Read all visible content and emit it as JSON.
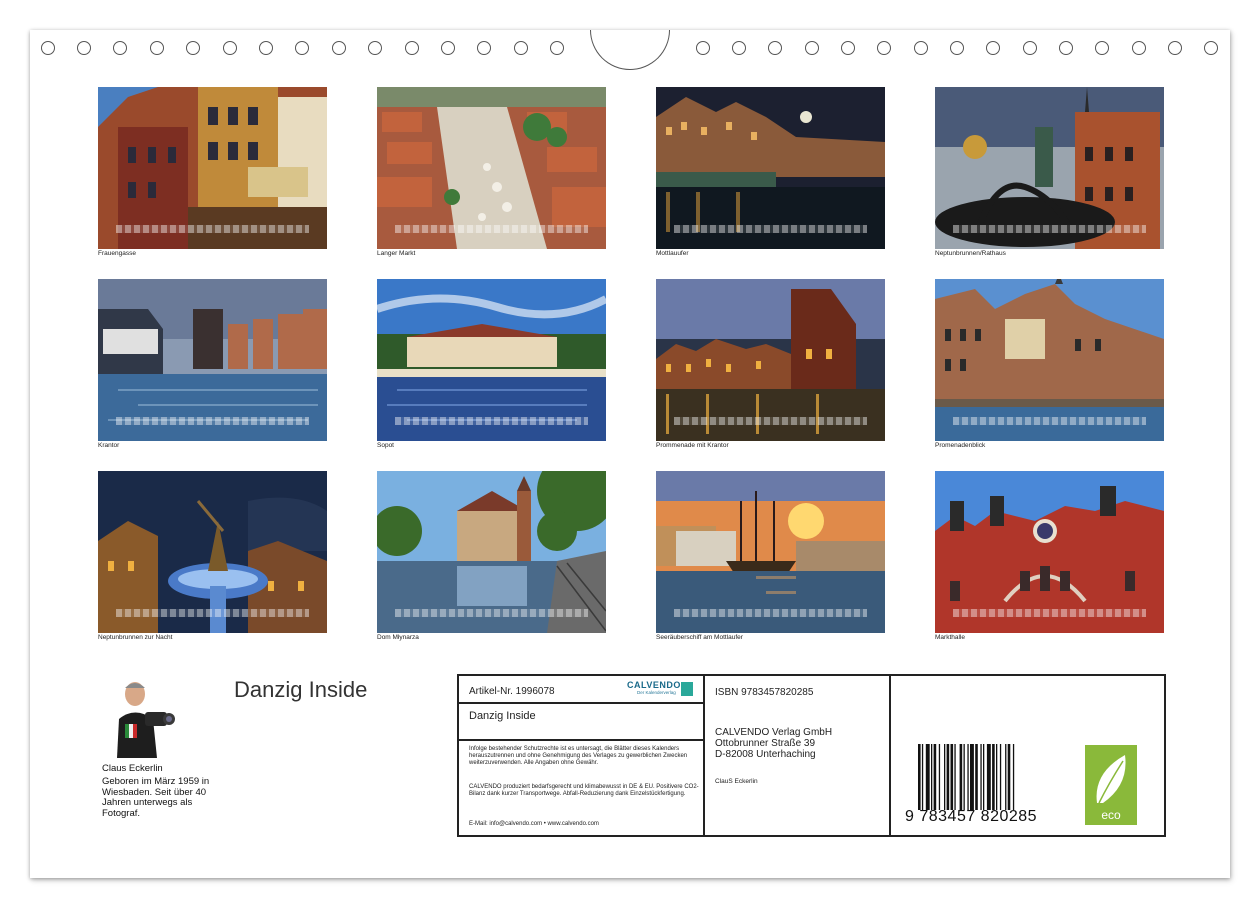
{
  "photos": [
    {
      "caption": "Frauengasse"
    },
    {
      "caption": "Langer Markt"
    },
    {
      "caption": "Mottlauufer"
    },
    {
      "caption": "Neptunbrunnen/Rathaus"
    },
    {
      "caption": "Krantor"
    },
    {
      "caption": "Sopot"
    },
    {
      "caption": "Prommenade mit Krantor"
    },
    {
      "caption": "Promenadenblick"
    },
    {
      "caption": "Neptunbrunnen zur Nacht"
    },
    {
      "caption": "Dom Młynarza"
    },
    {
      "caption": "Seeräuberschiff am Mottlaufer"
    },
    {
      "caption": "Markthalle"
    }
  ],
  "title": "Danzig Inside",
  "author": {
    "name": "Claus Eckerlin",
    "bio": "Geboren im März 1959 in Wiesbaden. Seit über 40 Jahren unterwegs als Fotograf."
  },
  "info": {
    "article": "Artikel-Nr. 1996078",
    "brand": "CALVENDO",
    "brand_tagline": "Der Kalenderverlag",
    "title": "Danzig Inside",
    "rights": "Infolge bestehender Schutzrechte ist es untersagt, die Blätter dieses Kalenders herauszutrennen und ohne Genehmigung des Verlages zu gewerblichen Zwecken weiterzuverwenden. Alle Angaben ohne Gewähr.",
    "production": "CALVENDO produziert bedarfsgerecht und klimabewusst in DE & EU. Positivere CO2-Bilanz dank kurzer Transportwege. Abfall-Reduzierung dank Einzelstückfertigung.",
    "contact": "E-Mail: info@calvendo.com • www.calvendo.com",
    "isbn": "ISBN 9783457820285",
    "publisher_name": "CALVENDO Verlag GmbH",
    "publisher_street": "Ottobrunner Straße 39",
    "publisher_city": "D-82008 Unterhaching",
    "photographer": "ClauS Eckerlin",
    "barcode_digits": "9 783457 820285",
    "eco_label": "eco"
  }
}
